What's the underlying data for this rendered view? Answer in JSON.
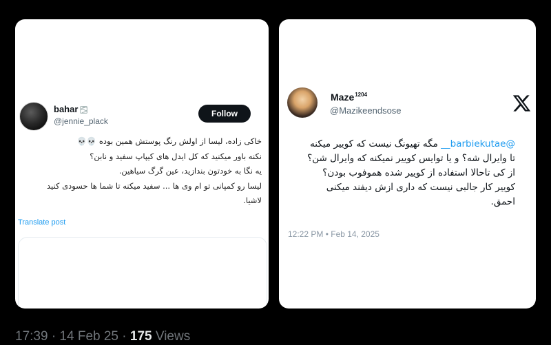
{
  "left_tweet": {
    "name": "bahar",
    "name_emoji": "🌫",
    "handle": "@jennie_plack",
    "follow_label": "Follow",
    "lines": [
      "خاکی زاده، لیسا از اولش رنگ پوستش همین بوده 💀💀",
      "نکنه باور میکنید که کل ایدل های کیپاپ سفید و نابن؟",
      "یه نگا به خودتون بندازید، عین گرگ سیاهین.",
      "لیسا رو کمپانی تو ام وی ها ... سفید میکنه تا شما ها حسودی کنید",
      "لاشیا."
    ],
    "translate_label": "Translate post"
  },
  "right_tweet": {
    "name": "Maze",
    "name_sup": "1204",
    "handle": "@Mazikeendsose",
    "mention": "@barbiekutae__",
    "line1_rest": "مگه تهیونگ نیست که کوییر میکنه",
    "lines": [
      "تا وایرال شه؟ و یا توایس کوییر نمیکنه که وایرال شن؟",
      "از کی تاحالا استفاده از کوییر شده هموفوب بودن؟",
      "کوییر کار جالبی نیست که داری ازش دیفند میکنی",
      "احمق."
    ],
    "timestamp": "12:22 PM • Feb 14, 2025",
    "logo": "x-logo"
  },
  "footer": {
    "time": "17:39 · 14 Feb 25 · ",
    "views_count": "175",
    "views_label": " Views"
  },
  "colors": {
    "background": "#000000",
    "link": "#1d9bf0",
    "follow_bg": "#0f1419"
  }
}
